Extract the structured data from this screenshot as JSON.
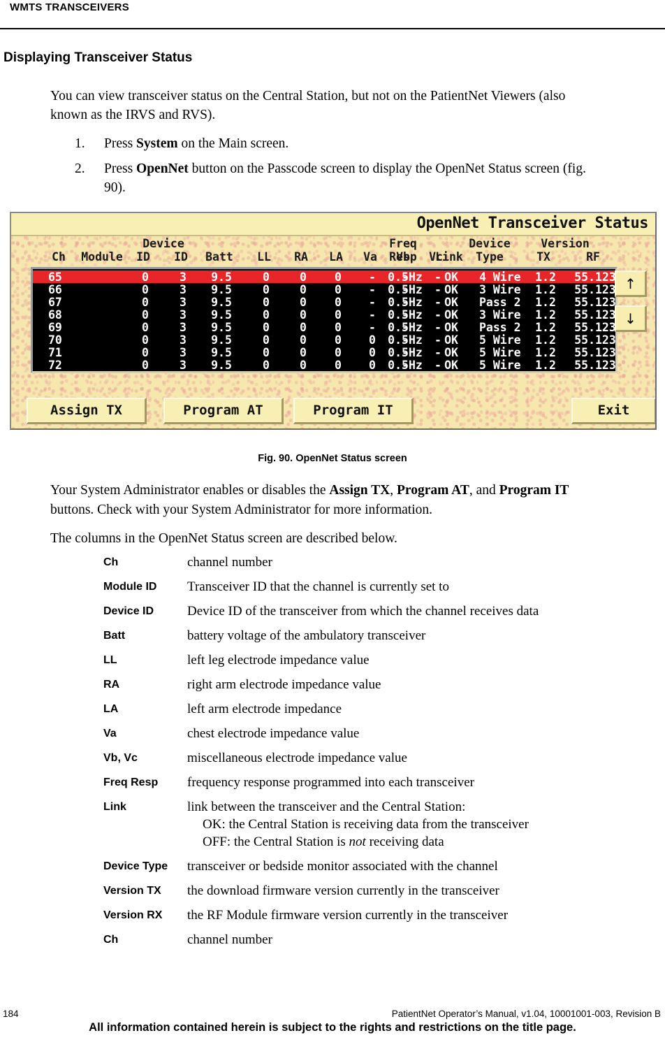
{
  "page": {
    "running_head": "WMTS TRANSCEIVERS",
    "section_title": "Displaying Transceiver Status",
    "intro_paragraph": "You can view transceiver status on the Central Station, but not on the PatientNet Viewers (also known as the IRVS and RVS).",
    "steps": [
      {
        "num": "1.",
        "pre": "Press ",
        "bold": "System",
        "post": " on the Main screen."
      },
      {
        "num": "2.",
        "pre": "Press ",
        "bold": "OpenNet",
        "post": " button on the Passcode screen to display the OpenNet Status screen (fig. 90)."
      }
    ],
    "figure_caption": "Fig. 90. OpenNet Status screen",
    "post_para_1": {
      "a": "Your System Administrator enables or disables the ",
      "b1": "Assign TX",
      "c": ", ",
      "b2": "Program AT",
      "d": ", and ",
      "b3": "Program IT",
      "e": " buttons. Check with your System Administrator for more information."
    },
    "post_para_2": "The columns in the OpenNet Status screen are described below."
  },
  "screen": {
    "title": "OpenNet Transceiver Status",
    "header_top": [
      "Device",
      "Freq",
      "Device",
      "Version"
    ],
    "header_bottom": [
      "Ch",
      "Module",
      "ID",
      "ID",
      "Batt",
      "LL",
      "RA",
      "LA",
      "Va",
      "Vb",
      "Vc",
      "Resp",
      "Link",
      "Type",
      "TX",
      "RF"
    ],
    "columns": [
      "Ch",
      "Module",
      "Device ID",
      "ID",
      "Batt",
      "LL",
      "RA",
      "LA",
      "Va",
      "Vb",
      "Vc",
      "Freq Resp",
      "Link",
      "Device Type",
      "Version TX",
      "Version RF"
    ],
    "rows": [
      {
        "ch": "65",
        "module": "",
        "device_id": "0",
        "id": "3",
        "batt": "9.5",
        "ll": "0",
        "ra": "0",
        "la": "0",
        "va": "-",
        "vb": "-",
        "vc": "-",
        "freq_resp": "0.5Hz",
        "link": "OK",
        "device_type": "4 Wire",
        "version_tx": "1.2",
        "version_rf": "55.123",
        "selected": true
      },
      {
        "ch": "66",
        "module": "",
        "device_id": "0",
        "id": "3",
        "batt": "9.5",
        "ll": "0",
        "ra": "0",
        "la": "0",
        "va": "-",
        "vb": "-",
        "vc": "-",
        "freq_resp": "0.5Hz",
        "link": "OK",
        "device_type": "3 Wire",
        "version_tx": "1.2",
        "version_rf": "55.123",
        "selected": false
      },
      {
        "ch": "67",
        "module": "",
        "device_id": "0",
        "id": "3",
        "batt": "9.5",
        "ll": "0",
        "ra": "0",
        "la": "0",
        "va": "-",
        "vb": "-",
        "vc": "-",
        "freq_resp": "0.5Hz",
        "link": "OK",
        "device_type": "Pass 2",
        "version_tx": "1.2",
        "version_rf": "55.123",
        "selected": false
      },
      {
        "ch": "68",
        "module": "",
        "device_id": "0",
        "id": "3",
        "batt": "9.5",
        "ll": "0",
        "ra": "0",
        "la": "0",
        "va": "-",
        "vb": "-",
        "vc": "-",
        "freq_resp": "0.5Hz",
        "link": "OK",
        "device_type": "3 Wire",
        "version_tx": "1.2",
        "version_rf": "55.123",
        "selected": false
      },
      {
        "ch": "69",
        "module": "",
        "device_id": "0",
        "id": "3",
        "batt": "9.5",
        "ll": "0",
        "ra": "0",
        "la": "0",
        "va": "-",
        "vb": "-",
        "vc": "-",
        "freq_resp": "0.5Hz",
        "link": "OK",
        "device_type": "Pass 2",
        "version_tx": "1.2",
        "version_rf": "55.123",
        "selected": false
      },
      {
        "ch": "70",
        "module": "",
        "device_id": "0",
        "id": "3",
        "batt": "9.5",
        "ll": "0",
        "ra": "0",
        "la": "0",
        "va": "0",
        "vb": "-",
        "vc": "-",
        "freq_resp": "0.5Hz",
        "link": "OK",
        "device_type": "5 Wire",
        "version_tx": "1.2",
        "version_rf": "55.123",
        "selected": false
      },
      {
        "ch": "71",
        "module": "",
        "device_id": "0",
        "id": "3",
        "batt": "9.5",
        "ll": "0",
        "ra": "0",
        "la": "0",
        "va": "0",
        "vb": "-",
        "vc": "-",
        "freq_resp": "0.5Hz",
        "link": "OK",
        "device_type": "5 Wire",
        "version_tx": "1.2",
        "version_rf": "55.123",
        "selected": false
      },
      {
        "ch": "72",
        "module": "",
        "device_id": "0",
        "id": "3",
        "batt": "9.5",
        "ll": "0",
        "ra": "0",
        "la": "0",
        "va": "0",
        "vb": "-",
        "vc": "-",
        "freq_resp": "0.5Hz",
        "link": "OK",
        "device_type": "5 Wire",
        "version_tx": "1.2",
        "version_rf": "55.123",
        "selected": false
      }
    ],
    "scroll_up_glyph": "↑",
    "scroll_down_glyph": "↓",
    "buttons": {
      "assign_tx": "Assign TX",
      "program_at": "Program AT",
      "program_it": "Program IT",
      "exit": "Exit"
    },
    "colors": {
      "title_bar": "#f8efb4",
      "desktop": "#f6e7ae",
      "grid_background": "#000000",
      "grid_text": "#ffffff",
      "selected_row": "#e8262a",
      "button_face": "#f8efb4"
    }
  },
  "glossary": [
    {
      "term": "Ch",
      "def": "channel number"
    },
    {
      "term": "Module ID",
      "def": "Transceiver ID that the channel is currently set to"
    },
    {
      "term": "Device ID",
      "def": "Device ID of the transceiver from which the channel receives data"
    },
    {
      "term": "Batt",
      "def": "battery voltage of the ambulatory transceiver"
    },
    {
      "term": "LL",
      "def": "left leg electrode impedance value"
    },
    {
      "term": "RA",
      "def": "right arm electrode impedance value"
    },
    {
      "term": "LA",
      "def": "left arm electrode impedance"
    },
    {
      "term": "Va",
      "def": "chest electrode impedance value"
    },
    {
      "term": "Vb, Vc",
      "def": "miscellaneous electrode impedance value"
    },
    {
      "term": "Freq Resp",
      "def": "frequency response programmed into each transceiver"
    },
    {
      "term": "Link",
      "def": "link between the transceiver and the Central Station:",
      "sub1": "OK: the Central Station is receiving data from the transceiver",
      "sub2_a": "OFF: the Central Station is ",
      "sub2_i": "not",
      "sub2_b": " receiving data"
    },
    {
      "term": "Device Type",
      "def": "transceiver or bedside monitor associated with the channel"
    },
    {
      "term": "Version TX",
      "def": "the download firmware version currently in the transceiver"
    },
    {
      "term": "Version RX",
      "def": "the RF Module firmware version currently in the transceiver"
    },
    {
      "term": "Ch",
      "def": "channel number"
    }
  ],
  "footer": {
    "page_number": "184",
    "reference": "PatientNet Operator’s Manual, v1.04, 10001001-003, Revision B",
    "notice": "All information contained herein is subject to the rights and restrictions on the title page."
  }
}
